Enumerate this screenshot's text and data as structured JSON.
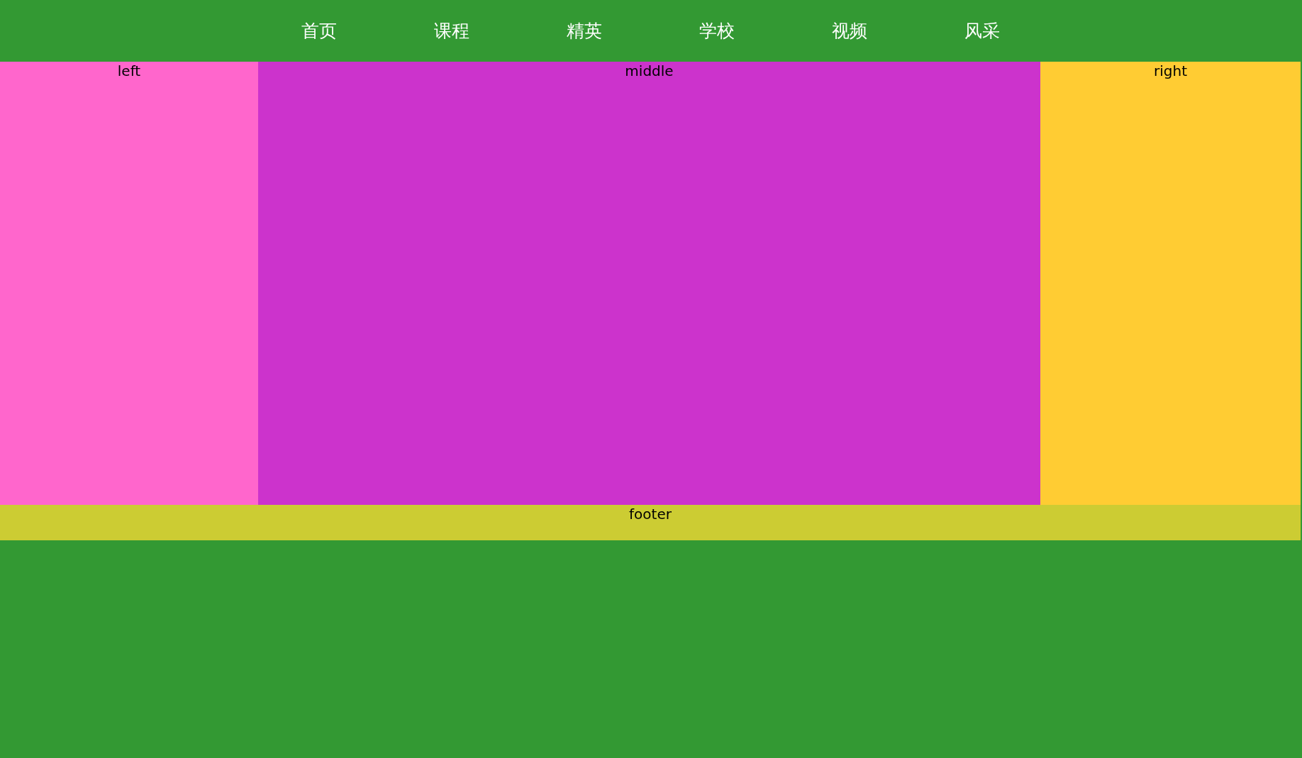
{
  "nav": {
    "items": [
      {
        "label": "首页"
      },
      {
        "label": "课程"
      },
      {
        "label": "精英"
      },
      {
        "label": "学校"
      },
      {
        "label": "视频"
      },
      {
        "label": "风采"
      }
    ]
  },
  "columns": [
    {
      "kind": "left",
      "label": "left"
    },
    {
      "kind": "middle",
      "label": "middle"
    },
    {
      "kind": "right",
      "label": "right"
    }
  ],
  "footer": {
    "label": "footer"
  }
}
